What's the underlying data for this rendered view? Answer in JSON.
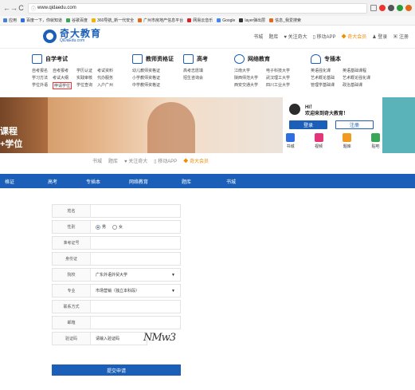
{
  "browser": {
    "url": "www.qidaedu.com",
    "bookmarks": [
      "应用",
      "百度一下，你就知道",
      "谷歌百度",
      "360导航_新一代安全",
      "广州市房地产信息平台",
      "网易云音乐",
      "Google",
      "layer弹出层",
      "信息_我爱搜索"
    ]
  },
  "header": {
    "logo_cn": "奇大教育",
    "logo_en": "QiDaEdu.com",
    "links": [
      "书城",
      "题库",
      "关注奇大",
      "移动APP",
      "奇大会员",
      "登录",
      "注册"
    ]
  },
  "menu": {
    "c1": {
      "title": "自学考试",
      "links": [
        "自考报名",
        "自考报考",
        "学历认证",
        "考试资料",
        "学习方法",
        "考试大纲",
        "实践审核",
        "代办服务",
        "学位外语",
        "申请学位",
        "学位查询",
        "入户广州"
      ]
    },
    "c2": {
      "title": "教师资格证",
      "links": [
        "幼儿教师资格证",
        "小学教师资格证",
        "中学教师资格证"
      ]
    },
    "c3": {
      "title": "高考",
      "links": [
        "高考志愿填",
        "招生咨询会"
      ]
    },
    "c4": {
      "title": "网络教育",
      "links": [
        "江南大学",
        "电子科技大学",
        "陕西师范大学",
        "武汉理工大学",
        "西安交通大学",
        "四川工业大学"
      ]
    },
    "c5": {
      "title": "专插本",
      "links": [
        "英语强化课",
        "英语基础课程",
        "艺术概论基础",
        "艺术概论强化课",
        "管理学基础课",
        "政治基础课"
      ]
    }
  },
  "banner": {
    "line1": "课程",
    "line2": "+学位"
  },
  "login": {
    "hi": "HI！",
    "welcome": "欢迎来到奇大教育！",
    "login_btn": "登录",
    "register_btn": "注册",
    "quick": [
      "书城",
      "视频",
      "题库",
      "贴吧"
    ]
  },
  "ghost": [
    "书城",
    "题库",
    "关注奇大",
    "移动APP",
    "奇大会员"
  ],
  "nav": [
    "格证",
    "高考",
    "专插本",
    "网络教育",
    "题库",
    "书城"
  ],
  "form": {
    "name_label": "姓名",
    "gender_label": "性别",
    "gender_options": [
      "男",
      "女"
    ],
    "id_label": "准考证号",
    "idcard_label": "身份证",
    "school_label": "院校",
    "school_value": "广东外语外贸大学",
    "major_label": "专业",
    "major_value": "市场营销（独立本科段）",
    "contact_label": "联系方式",
    "email_label": "邮箱",
    "captcha_label": "验证码",
    "captcha_placeholder": "请输入验证码",
    "captcha_image": "NMw3",
    "submit_label": "提交申请"
  },
  "colors": {
    "brand": "#1b5fb8",
    "vip": "#f08c00",
    "highlight": "#e33"
  }
}
